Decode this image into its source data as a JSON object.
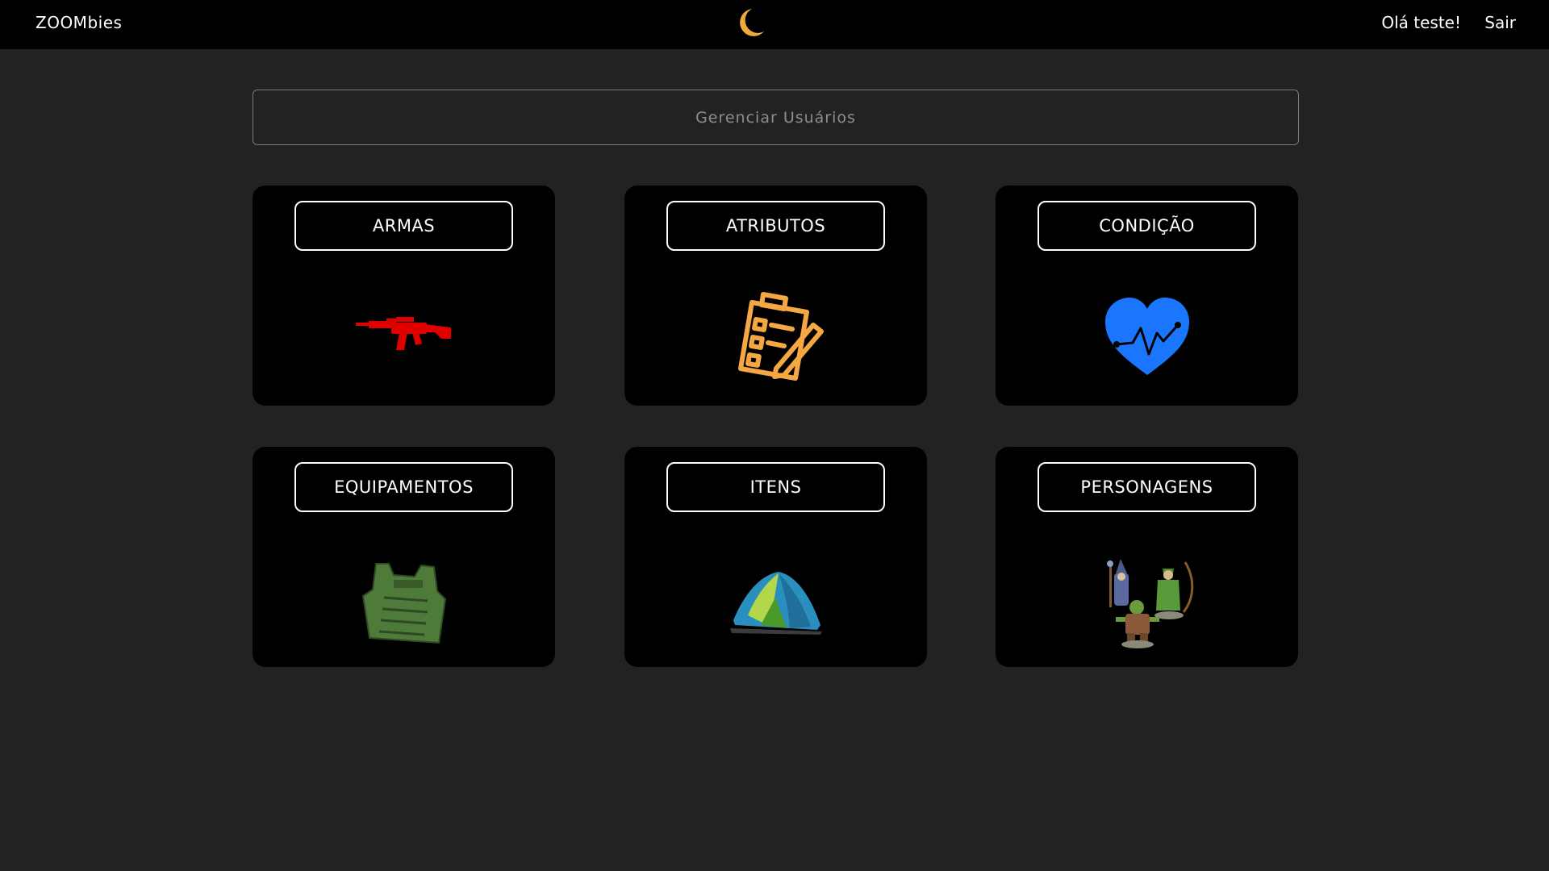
{
  "header": {
    "brand": "ZOOMbies",
    "theme_icon": "moon-icon",
    "greeting": "Olá teste!",
    "logout_label": "Sair"
  },
  "manage_users": {
    "label": "Gerenciar Usuários"
  },
  "cards": [
    {
      "label": "ARMAS",
      "icon": "rifle-icon"
    },
    {
      "label": "ATRIBUTOS",
      "icon": "clipboard-checklist-icon"
    },
    {
      "label": "CONDIÇÃO",
      "icon": "heart-pulse-icon"
    },
    {
      "label": "EQUIPAMENTOS",
      "icon": "tactical-vest-icon"
    },
    {
      "label": "ITENS",
      "icon": "tent-icon"
    },
    {
      "label": "PERSONAGENS",
      "icon": "characters-figures-icon"
    }
  ],
  "colors": {
    "topbar": "#000000",
    "background": "#222222",
    "moon": "#f0a93b",
    "rifle": "#e00000",
    "clipboard": "#f5a742",
    "heart": "#1a75ff",
    "vest": "#4e7a3a"
  }
}
